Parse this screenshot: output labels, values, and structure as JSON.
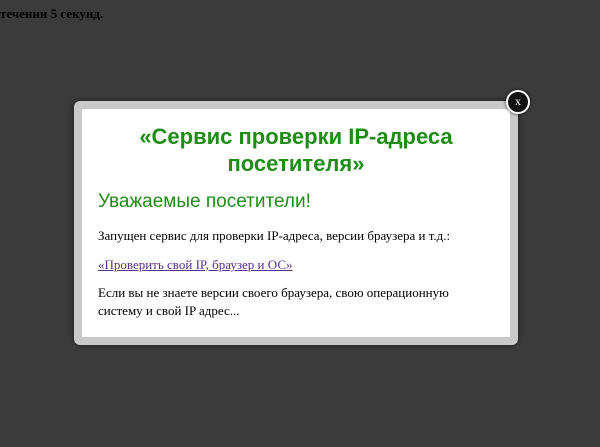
{
  "background": {
    "text": "течении 5 секунд."
  },
  "modal": {
    "title": "«Сервис проверки IP-адреса посетителя»",
    "subtitle": "Уважаемые посетители!",
    "paragraph1": "Запущен сервис для проверки IP-адреса, версии браузера и т.д.:",
    "link": "«Проверить свой IP, браузер и ОС»",
    "paragraph2": "Если вы не знаете версии своего браузера, свою операционную систему и свой IP адрес...",
    "close_label": "x"
  },
  "colors": {
    "overlay": "#3b3b3b",
    "title_green": "#1f8c16",
    "link_visited": "#5a2f86",
    "frame_gray": "#c9c9c9"
  }
}
